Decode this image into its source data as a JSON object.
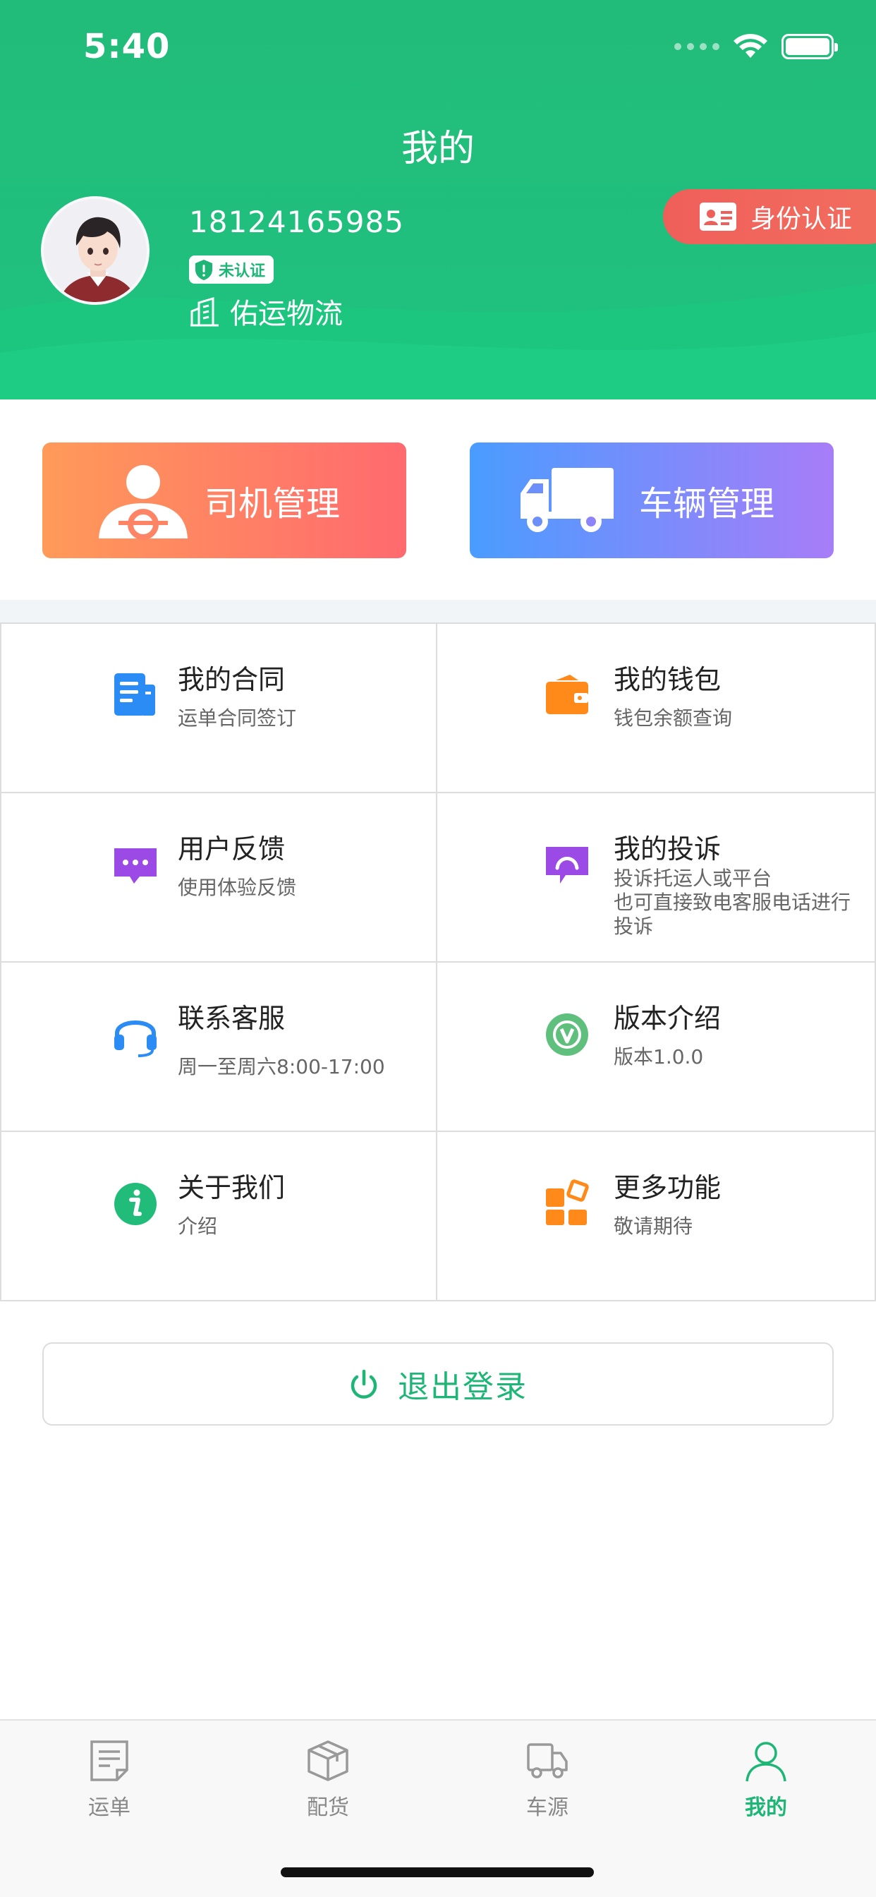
{
  "status": {
    "time": "5:40"
  },
  "header": {
    "title": "我的",
    "phone": "18124165985",
    "verify_tag": "未认证",
    "company": "佑运物流",
    "id_auth_label": "身份认证"
  },
  "actions": {
    "driver_label": "司机管理",
    "vehicle_label": "车辆管理"
  },
  "menu": {
    "items": [
      {
        "title": "我的合同",
        "sub": "运单合同签订",
        "icon": "contract-icon",
        "color": "#2a8cf4"
      },
      {
        "title": "我的钱包",
        "sub": "钱包余额查询",
        "icon": "wallet-icon",
        "color": "#ff8a1a"
      },
      {
        "title": "用户反馈",
        "sub": "使用体验反馈",
        "icon": "feedback-icon",
        "color": "#9b4ae6"
      },
      {
        "title": "我的投诉",
        "sub": "投诉托运人或平台\n也可直接致电客服电话进行投诉",
        "icon": "complaint-icon",
        "color": "#9b4ae6"
      },
      {
        "title": "联系客服",
        "sub": "周一至周六8:00-17:00",
        "icon": "headset-icon",
        "color": "#2a8cf4"
      },
      {
        "title": "版本介绍",
        "sub": "版本1.0.0",
        "icon": "version-icon",
        "color": "#5fbf7c"
      },
      {
        "title": "关于我们",
        "sub": "介绍",
        "icon": "info-icon",
        "color": "#22bc7a"
      },
      {
        "title": "更多功能",
        "sub": "敬请期待",
        "icon": "more-icon",
        "color": "#ff8a1a"
      }
    ]
  },
  "logout": {
    "label": "退出登录"
  },
  "tabbar": {
    "tabs": [
      {
        "label": "运单"
      },
      {
        "label": "配货"
      },
      {
        "label": "车源"
      },
      {
        "label": "我的"
      }
    ],
    "active_color": "#1db676"
  }
}
